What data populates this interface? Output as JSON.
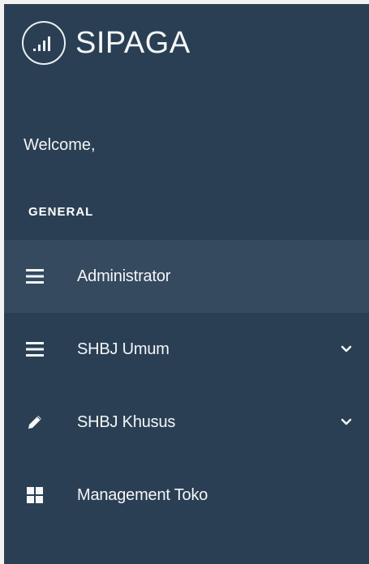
{
  "brand": {
    "title": "SIPAGA",
    "logo_icon": "signal-bars-icon"
  },
  "welcome": {
    "text": "Welcome,"
  },
  "section": {
    "title": "GENERAL"
  },
  "menu": {
    "items": [
      {
        "label": "Administrator",
        "icon": "bars-icon",
        "active": true,
        "has_submenu": false
      },
      {
        "label": "SHBJ Umum",
        "icon": "bars-icon",
        "active": false,
        "has_submenu": true
      },
      {
        "label": "SHBJ Khusus",
        "icon": "pencil-icon",
        "active": false,
        "has_submenu": true
      },
      {
        "label": "Management Toko",
        "icon": "grid-icon",
        "active": false,
        "has_submenu": false
      }
    ]
  },
  "colors": {
    "sidebar_bg": "#2a3f54",
    "active_bg": "#354a5f",
    "text": "#f4f6f7"
  }
}
